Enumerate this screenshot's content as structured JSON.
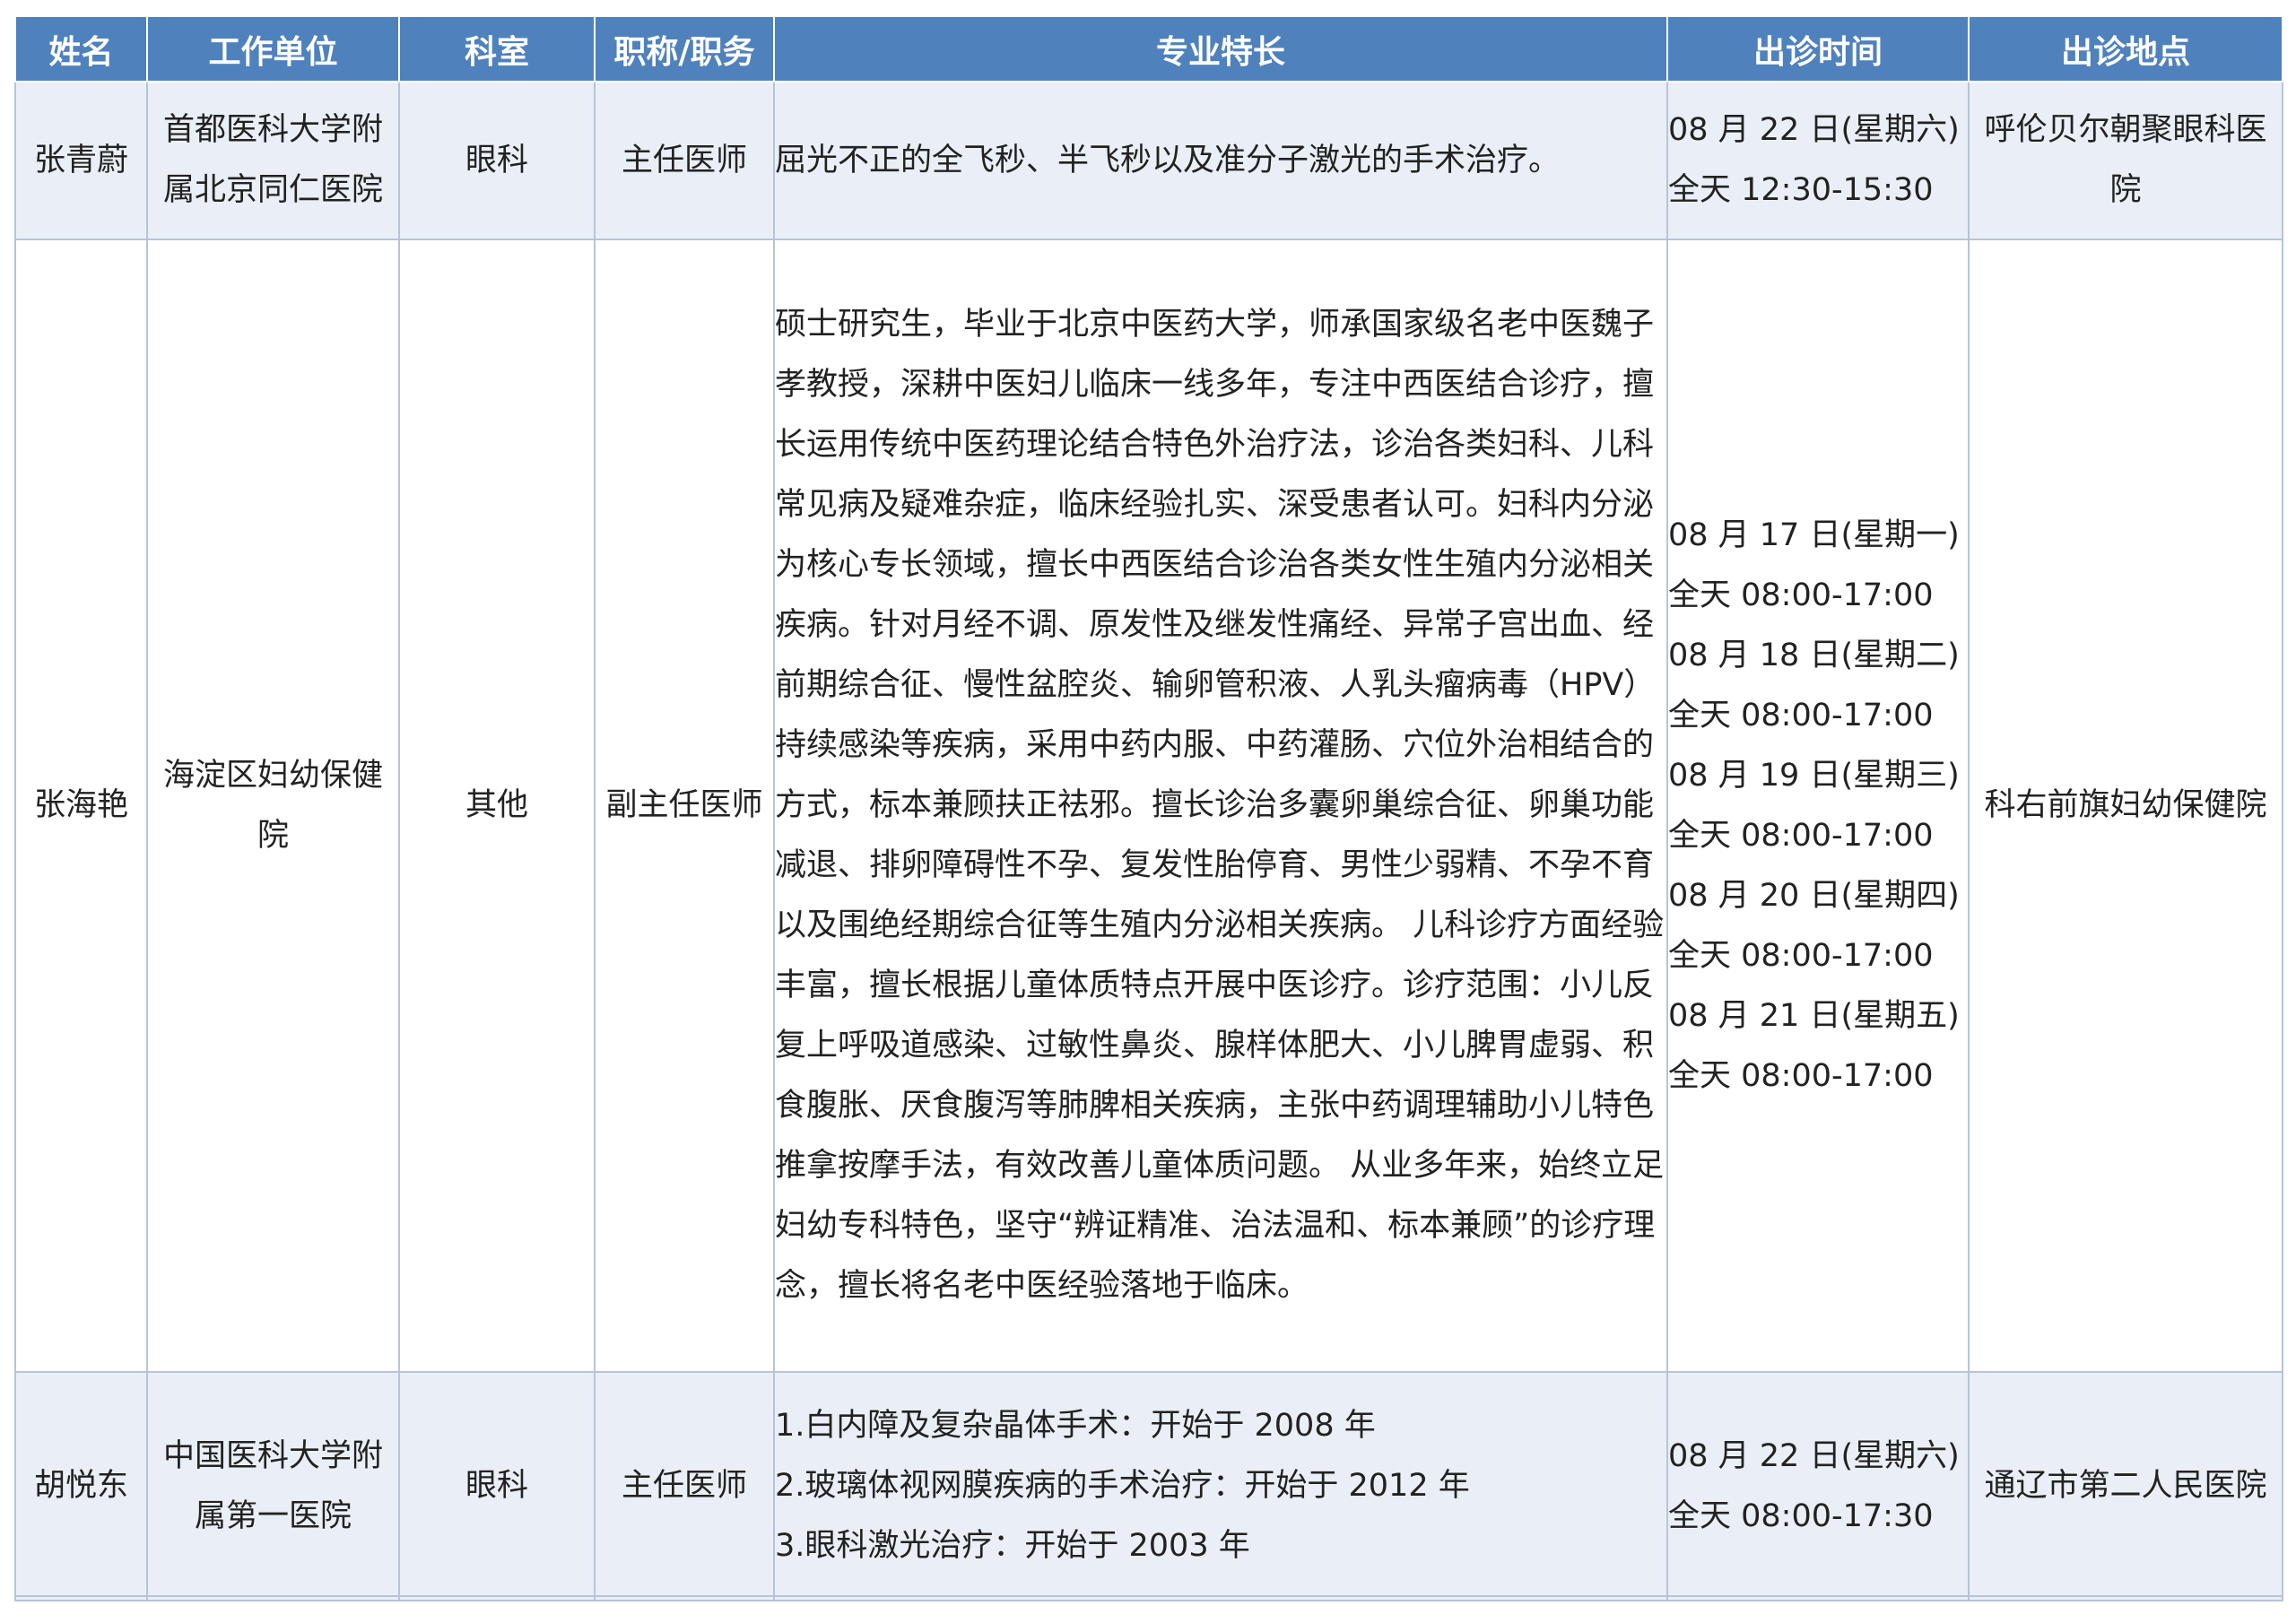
{
  "header": {
    "name": "姓名",
    "unit": "工作单位",
    "department": "科室",
    "title": "职称/职务",
    "specialty": "专业特长",
    "time": "出诊时间",
    "location": "出诊地点"
  },
  "rows": [
    {
      "name": "张青蔚",
      "unit": "首都医科大学附属北京同仁医院",
      "department": "眼科",
      "title": "主任医师",
      "specialty": "屈光不正的全飞秒、半飞秒以及准分子激光的手术治疗。",
      "time": [
        "08 月 22 日(星期六)",
        "全天 12:30-15:30"
      ],
      "location": "呼伦贝尔朝聚眼科医院"
    },
    {
      "name": "张海艳",
      "unit": "海淀区妇幼保健院",
      "department": "其他",
      "title": "副主任医师",
      "specialty": "硕士研究生，毕业于北京中医药大学，师承国家级名老中医魏子孝教授，深耕中医妇儿临床一线多年，专注中西医结合诊疗，擅长运用传统中医药理论结合特色外治疗法，诊治各类妇科、儿科常见病及疑难杂症，临床经验扎实、深受患者认可。妇科内分泌为核心专长领域，擅长中西医结合诊治各类女性生殖内分泌相关疾病。针对月经不调、原发性及继发性痛经、异常子宫出血、经前期综合征、慢性盆腔炎、输卵管积液、人乳头瘤病毒（HPV）持续感染等疾病，采用中药内服、中药灌肠、穴位外治相结合的方式，标本兼顾扶正祛邪。擅长诊治多囊卵巢综合征、卵巢功能减退、排卵障碍性不孕、复发性胎停育、男性少弱精、不孕不育以及围绝经期综合征等生殖内分泌相关疾病。 儿科诊疗方面经验丰富，擅长根据儿童体质特点开展中医诊疗。诊疗范围：小儿反复上呼吸道感染、过敏性鼻炎、腺样体肥大、小儿脾胃虚弱、积食腹胀、厌食腹泻等肺脾相关疾病，主张中药调理辅助小儿特色推拿按摩手法，有效改善儿童体质问题。 从业多年来，始终立足妇幼专科特色，坚守“辨证精准、治法温和、标本兼顾”的诊疗理念，擅长将名老中医经验落地于临床。",
      "time": [
        "08 月 17 日(星期一)",
        "全天 08:00-17:00",
        "08 月 18 日(星期二)",
        "全天 08:00-17:00",
        "08 月 19 日(星期三)",
        "全天 08:00-17:00",
        "08 月 20 日(星期四)",
        "全天 08:00-17:00",
        "08 月 21 日(星期五)",
        "全天 08:00-17:00"
      ],
      "location": "科右前旗妇幼保健院"
    },
    {
      "name": "胡悦东",
      "unit": "中国医科大学附属第一医院",
      "department": "眼科",
      "title": "主任医师",
      "specialty": [
        "1.白内障及复杂晶体手术：开始于 2008 年",
        "2.玻璃体视网膜疾病的手术治疗：开始于 2012 年",
        "3.眼科激光治疗：开始于 2003 年"
      ],
      "time": [
        "08 月 22 日(星期六)",
        "全天 08:00-17:30"
      ],
      "location": "通辽市第二人民医院"
    }
  ]
}
